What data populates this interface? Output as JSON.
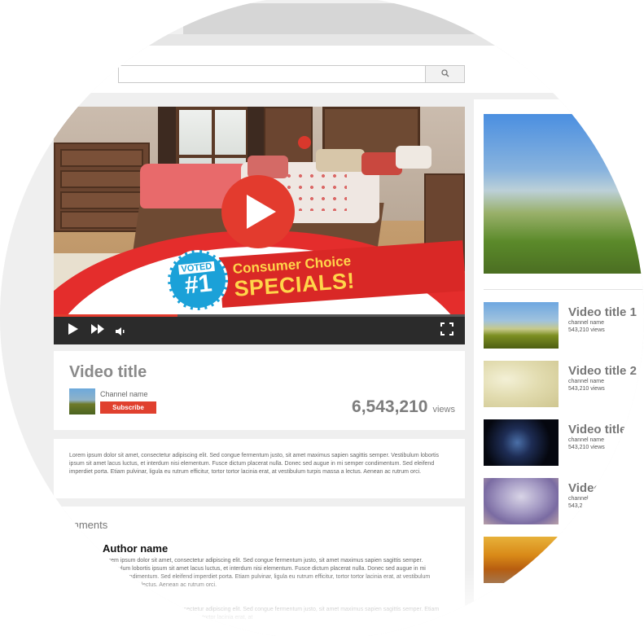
{
  "search": {
    "value": "",
    "icon": "search-icon"
  },
  "player": {
    "promo": {
      "badge_voted": "VOTED",
      "badge_rank": "#1",
      "line1": "Consumer Choice",
      "line2": "SPECIALS!"
    },
    "progress": 0.3,
    "icons": [
      "play-icon",
      "fast-forward-icon",
      "volume-icon",
      "fullscreen-icon"
    ]
  },
  "video": {
    "title": "Video title",
    "channel": "Channel name",
    "subscribe_label": "Subscribe",
    "views": "6,543,210",
    "views_label": "views"
  },
  "description": "Lorem ipsum dolor sit amet, consectetur adipiscing elit. Sed congue fermentum justo, sit amet maximus sapien sagittis semper. Vestibulum lobortis ipsum sit amet lacus luctus, et interdum nisi elementum. Fusce dictum placerat nulla. Donec sed augue in mi semper condimentum. Sed eleifend imperdiet porta. Etiam pulvinar, ligula eu rutrum efficitur, tortor tortor lacinia erat, at vestibulum turpis massa a lectus. Aenean ac rutrum orci.",
  "comments": {
    "heading": "mments",
    "author": "Author name",
    "text": "Lorem ipsum dolor sit amet, consectetur adipiscing elit. Sed congue fermentum justo, sit amet maximus sapien sagittis semper. Vestibulum lobortis ipsum sit amet lacus luctus, et interdum nisi elementum. Fusce dictum placerat nulla. Donec sed augue in mi semper condimentum. Sed eleifend imperdiet porta. Etiam pulvinar, ligula eu rutrum efficitur, tortor tortor lacinia erat, at vestibulum turpis massa a lectus. Aenean ac rutrum orci.",
    "text2": "Lorem ipsum dolor sit amet, consectetur adipiscing elit. Sed congue fermentum justo, sit amet maximus sapien sagittis semper. Etiam pulvinar, ligula eu rutrum efficitur, tortor tortor lacinia erat, at"
  },
  "sidebar": {
    "items": [
      {
        "title": "Video title 1",
        "channel": "channel name",
        "views": "543,210 views"
      },
      {
        "title": "Video title 2",
        "channel": "channel name",
        "views": "543,210 views"
      },
      {
        "title": "Video title",
        "channel": "channel name",
        "views": "543,210 views"
      },
      {
        "title": "Video",
        "channel": "channel",
        "views": "543,2"
      },
      {
        "title": "",
        "channel": "",
        "views": ""
      }
    ]
  },
  "colors": {
    "accent": "#e33b2e",
    "badge_blue": "#1ba1d8",
    "promo_yellow": "#ffd54a"
  }
}
